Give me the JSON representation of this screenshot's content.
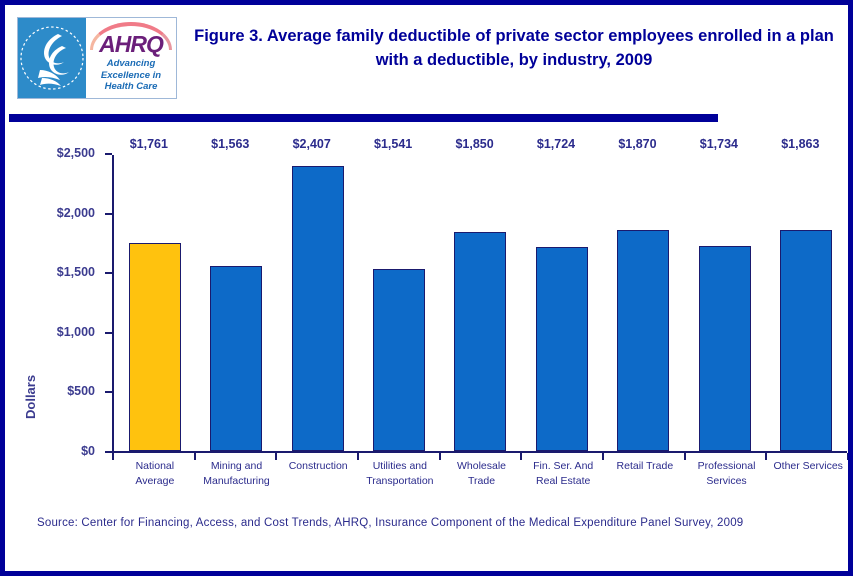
{
  "header": {
    "title": "Figure 3. Average family deductible of private sector employees enrolled in a plan with a deductible, by industry, 2009",
    "logo": {
      "wordmark": "AHRQ",
      "tagline": "Advancing\nExcellence in\nHealth Care",
      "seal_alt": "DEPARTMENT OF HEALTH & HUMAN SERVICES USA"
    }
  },
  "source": {
    "text": "Source: Center for Financing, Access, and Cost Trends, AHRQ, Insurance Component of the Medical Expenditure Panel Survey, 2009"
  },
  "colors": {
    "title": "#000099",
    "border": "#000099",
    "highlight_bar": "#FFC20E",
    "bar": "#0D6AC8",
    "bar_outline": "#1A1A6E",
    "axis_text": "#2B2B8C"
  },
  "chart_data": {
    "type": "bar",
    "title": "Figure 3. Average family deductible of private sector employees enrolled in a plan with a deductible, by industry, 2009",
    "xlabel": "",
    "ylabel": "Dollars",
    "ylim": [
      0,
      2500
    ],
    "yticks": [
      0,
      500,
      1000,
      1500,
      2000,
      2500
    ],
    "ytick_labels": [
      "$0",
      "$500",
      "$1,000",
      "$1,500",
      "$2,000",
      "$2,500"
    ],
    "grid": false,
    "legend": false,
    "categories": [
      "National Average",
      "Mining and Manufacturing",
      "Construction",
      "Utilities and Transportation",
      "Wholesale Trade",
      "Fin. Ser. And Real Estate",
      "Retail Trade",
      "Professional Services",
      "Other Services"
    ],
    "category_lines": [
      "National\nAverage",
      "Mining and\nManufacturing",
      "Construction",
      "Utilities and\nTransportation",
      "Wholesale\nTrade",
      "Fin. Ser. And\nReal Estate",
      "Retail Trade",
      "Professional\nServices",
      "Other Services"
    ],
    "values": [
      1761,
      1563,
      2407,
      1541,
      1850,
      1724,
      1870,
      1734,
      1863
    ],
    "value_labels": [
      "$1,761",
      "$1,563",
      "$2,407",
      "$1,541",
      "$1,850",
      "$1,724",
      "$1,870",
      "$1,734",
      "$1,863"
    ],
    "bar_colors": [
      "#FFC20E",
      "#0D6AC8",
      "#0D6AC8",
      "#0D6AC8",
      "#0D6AC8",
      "#0D6AC8",
      "#0D6AC8",
      "#0D6AC8",
      "#0D6AC8"
    ]
  }
}
